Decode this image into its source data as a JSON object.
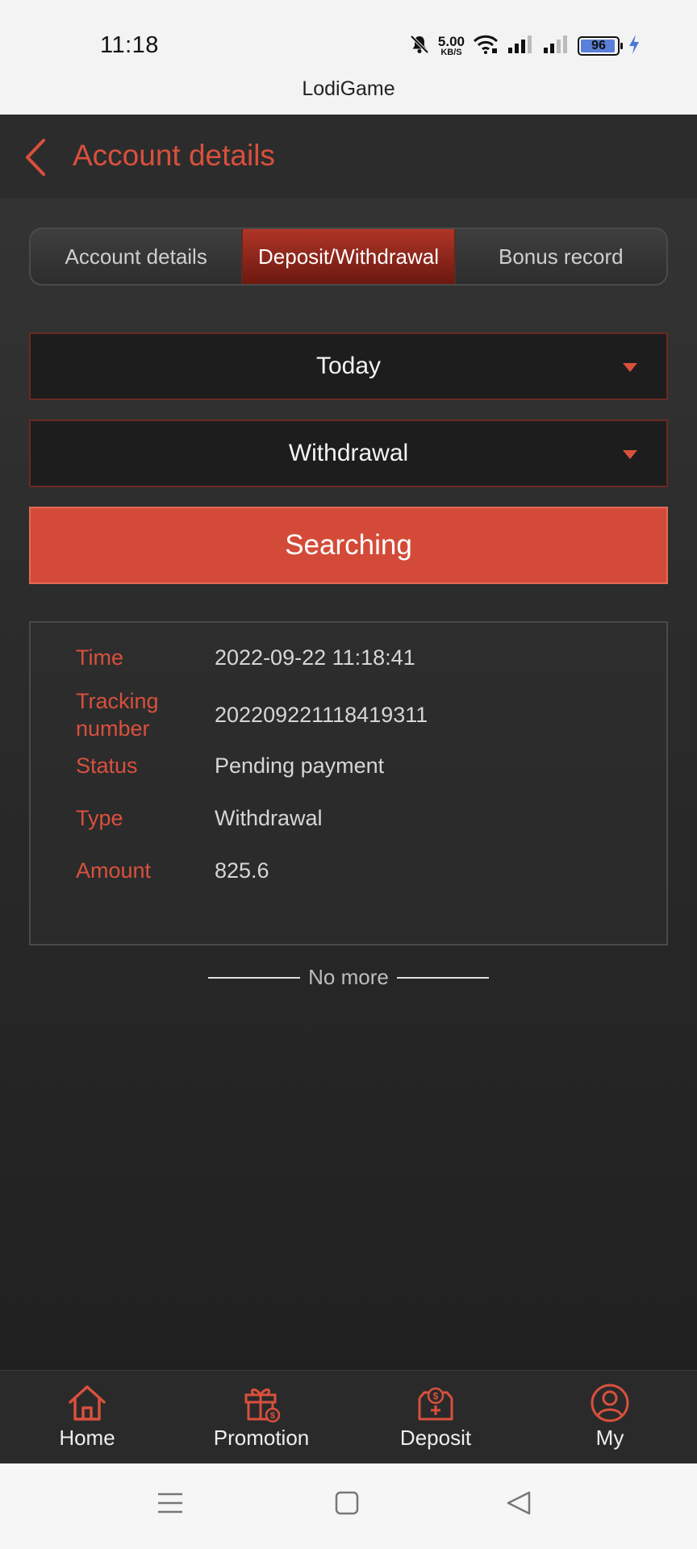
{
  "status_bar": {
    "time": "11:18",
    "net_speed_value": "5.00",
    "net_speed_unit": "KB/S",
    "battery_level": "96",
    "battery_fraction": 0.96,
    "icons": [
      "mute-bell-icon",
      "wifi-icon",
      "signal-icon",
      "signal-icon",
      "battery-icon",
      "charging-icon"
    ]
  },
  "browser": {
    "title": "LodiGame"
  },
  "header": {
    "back_icon": "chevron-left-icon",
    "title": "Account details"
  },
  "tabs": [
    {
      "label": "Account details",
      "active": false
    },
    {
      "label": "Deposit/Withdrawal",
      "active": true
    },
    {
      "label": "Bonus record",
      "active": false
    }
  ],
  "filters": {
    "date_value": "Today",
    "type_value": "Withdrawal"
  },
  "search_button": {
    "label": "Searching"
  },
  "record": {
    "time_label": "Time",
    "time_value": "2022-09-22 11:18:41",
    "tracking_label": "Tracking number",
    "tracking_value": "202209221118419311",
    "status_label": "Status",
    "status_value": "Pending payment",
    "type_label": "Type",
    "type_value": "Withdrawal",
    "amount_label": "Amount",
    "amount_value": "825.6"
  },
  "list_end": {
    "text": "No more"
  },
  "bottom_nav": [
    {
      "label": "Home",
      "icon": "home-icon"
    },
    {
      "label": "Promotion",
      "icon": "gift-icon"
    },
    {
      "label": "Deposit",
      "icon": "deposit-icon"
    },
    {
      "label": "My",
      "icon": "user-icon"
    }
  ],
  "colors": {
    "accent": "#d9503d",
    "button": "#d34b38",
    "background": "#2b2b2b"
  }
}
